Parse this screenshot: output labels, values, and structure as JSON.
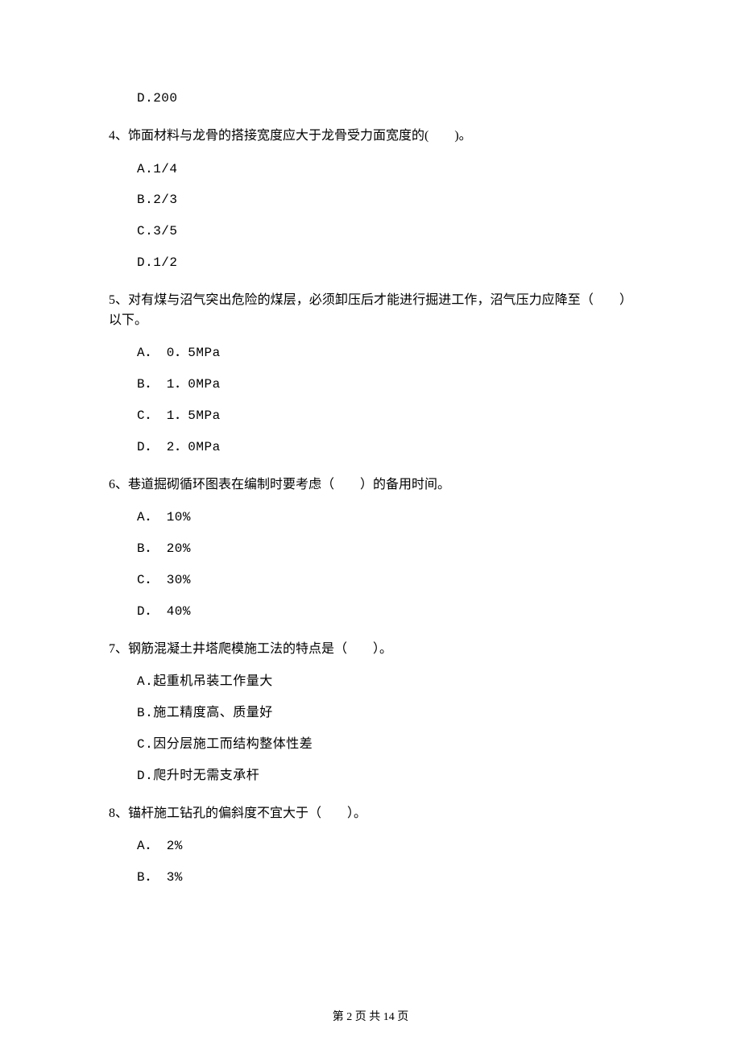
{
  "questions": [
    {
      "number": "",
      "text": "",
      "options": [
        "D.200"
      ]
    },
    {
      "number": "4、",
      "text": "饰面材料与龙骨的搭接宽度应大于龙骨受力面宽度的(　　)。",
      "options": [
        "A.1/4",
        "B.2/3",
        "C.3/5",
        "D.1/2"
      ]
    },
    {
      "number": "5、",
      "text": "对有煤与沼气突出危险的煤层，必须卸压后才能进行掘进工作，沼气压力应降至（　　）以下。",
      "options": [
        "A． 0．5MPa",
        "B． 1．0MPa",
        "C． 1．5MPa",
        "D． 2．0MPa"
      ]
    },
    {
      "number": "6、",
      "text": "巷道掘砌循环图表在编制时要考虑（　　）的备用时间。",
      "options": [
        "A． 10%",
        "B． 20%",
        "C． 30%",
        "D． 40%"
      ]
    },
    {
      "number": "7、",
      "text": "钢筋混凝土井塔爬模施工法的特点是（　　）。",
      "options": [
        "A.起重机吊装工作量大",
        "B.施工精度高、质量好",
        "C.因分层施工而结构整体性差",
        "D.爬升时无需支承杆"
      ]
    },
    {
      "number": "8、",
      "text": "锚杆施工钻孔的偏斜度不宜大于（　　）。",
      "options": [
        "A． 2%",
        "B． 3%"
      ]
    }
  ],
  "footer": "第 2 页 共 14 页"
}
